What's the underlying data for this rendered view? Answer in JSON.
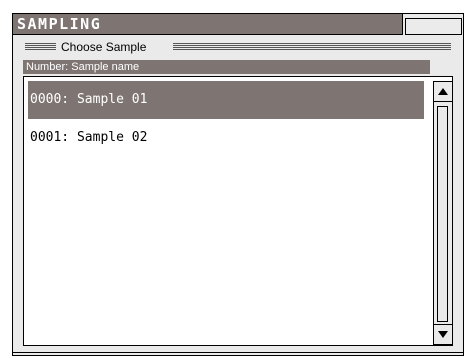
{
  "window": {
    "title": "SAMPLING"
  },
  "group": {
    "label": "Choose Sample"
  },
  "list": {
    "column_header": "Number: Sample name",
    "items": [
      {
        "label": "0000: Sample 01",
        "selected": true
      },
      {
        "label": "0001: Sample 02",
        "selected": false
      }
    ]
  },
  "scrollbar": {
    "up_icon": "arrow-up-icon",
    "down_icon": "arrow-down-icon"
  },
  "colors": {
    "title_bar": "#7e7573",
    "selection": "#7e7573",
    "panel": "#eaeaea",
    "list_bg": "#ffffff"
  }
}
